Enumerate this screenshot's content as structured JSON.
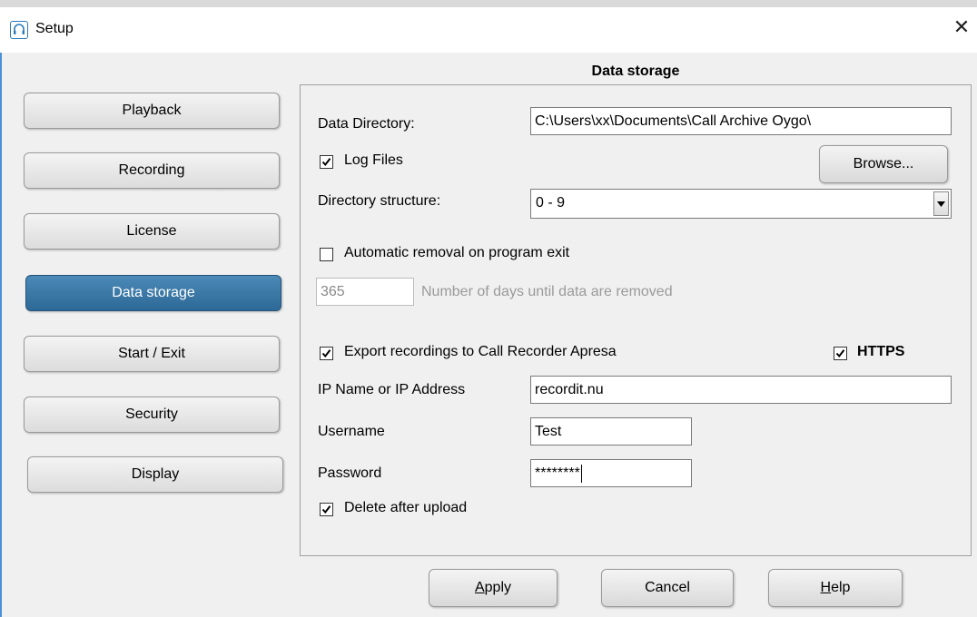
{
  "window": {
    "title": "Setup",
    "close_glyph": "✕"
  },
  "icons": {
    "app": "headset-icon",
    "close": "close-icon",
    "check": "checkmark-icon",
    "dropdown": "chevron-down-icon"
  },
  "colors": {
    "active_nav": "#2d6996",
    "window_edge": "#4a90d9",
    "disabled_text": "#9a9a9a"
  },
  "nav": {
    "items": [
      {
        "label": "Playback",
        "active": false
      },
      {
        "label": "Recording",
        "active": false
      },
      {
        "label": "License",
        "active": false
      },
      {
        "label": "Data storage",
        "active": true
      },
      {
        "label": "Start / Exit",
        "active": false
      },
      {
        "label": "Security",
        "active": false
      },
      {
        "label": "Display",
        "active": false
      }
    ]
  },
  "section": {
    "title": "Data storage"
  },
  "data_directory": {
    "label": "Data Directory:",
    "value": "C:\\Users\\xx\\Documents\\Call Archive Oygo\\"
  },
  "log_files": {
    "label": "Log Files",
    "checked": true
  },
  "browse": {
    "label": "Browse..."
  },
  "directory_structure": {
    "label": "Directory structure:",
    "value": "0 - 9"
  },
  "auto_removal": {
    "label": "Automatic removal on program exit",
    "checked": false,
    "days_value": "365",
    "days_label": "Number of days until data are removed"
  },
  "export": {
    "label": "Export recordings to Call Recorder Apresa",
    "checked": true,
    "https_label": "HTTPS",
    "https_checked": true
  },
  "ip": {
    "label": "IP Name or IP Address",
    "value": "recordit.nu"
  },
  "username": {
    "label": "Username",
    "value": "Test"
  },
  "password": {
    "label": "Password",
    "value": "********"
  },
  "delete_after_upload": {
    "label": "Delete after upload",
    "checked": true
  },
  "footer": {
    "apply_accel": "A",
    "apply_rest": "pply",
    "cancel": "Cancel",
    "help_accel": "H",
    "help_rest": "elp"
  }
}
